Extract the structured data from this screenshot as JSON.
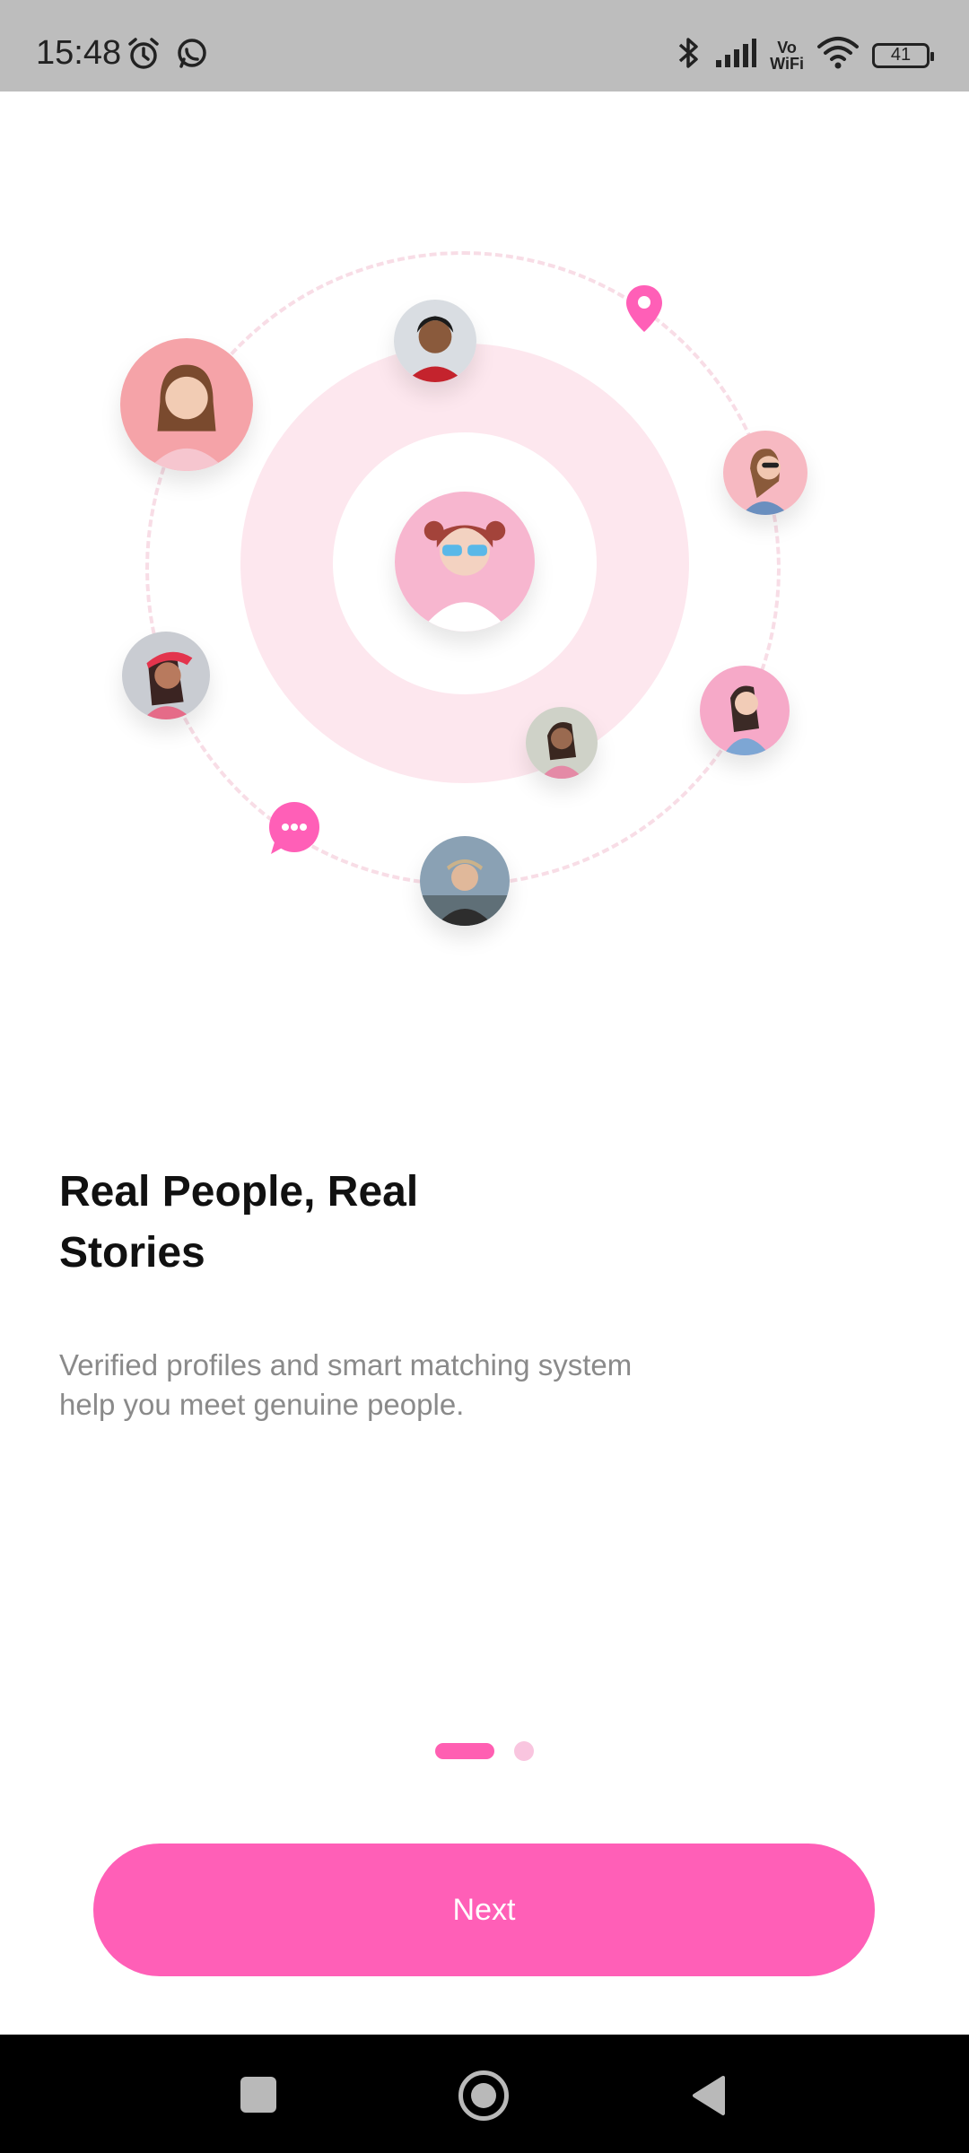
{
  "status_bar": {
    "time": "15:48",
    "left_icons": [
      "alarm-icon",
      "whatsapp-icon"
    ],
    "right_icons": [
      "bluetooth-icon",
      "signal-icon",
      "vowifi-icon",
      "wifi-icon",
      "battery-icon"
    ],
    "vowifi_top": "Vo",
    "vowifi_bottom": "WiFi",
    "battery_level": "41"
  },
  "onboarding": {
    "title": "Real People, Real Stories",
    "description": "Verified profiles and smart matching system help you meet genuine people.",
    "button_label": "Next",
    "pager": {
      "total": 2,
      "active": 1
    }
  },
  "illustration": {
    "icons": [
      "location-pin-icon",
      "chat-bubble-icon"
    ]
  },
  "colors": {
    "accent": "#ff5fb7",
    "ring": "#fde7ee",
    "title": "#111111",
    "description": "#8a8a8a",
    "status_bar": "#bdbdbd"
  },
  "nav_bar": {
    "buttons": [
      "recent-apps-icon",
      "home-icon",
      "back-icon"
    ]
  }
}
